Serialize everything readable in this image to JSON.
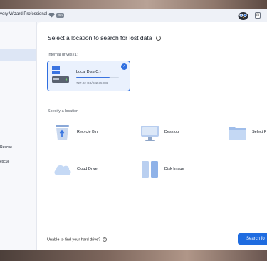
{
  "window": {
    "title": "very Wizard Professional",
    "badge": "Pro",
    "minimize": "⊡"
  },
  "sidebar": {
    "items": [
      {
        "label": ""
      },
      {
        "label": "Rescue"
      },
      {
        "label": "escue"
      }
    ]
  },
  "main": {
    "heading": "Select a location to search for lost data",
    "internal_label": "Internal drives (1)",
    "drive": {
      "name": "Local Disk(C:)",
      "size": "727.02 GB/932.35 GB",
      "used_fraction": 0.78
    },
    "specify_label": "Specify a location",
    "locations": [
      {
        "label": "Recycle Bin",
        "icon": "recycle-bin-icon"
      },
      {
        "label": "Desktop",
        "icon": "desktop-icon"
      },
      {
        "label": "Select F",
        "icon": "folder-icon"
      },
      {
        "label": "Cloud Drive",
        "icon": "cloud-icon"
      },
      {
        "label": "Disk Image",
        "icon": "disk-image-icon"
      }
    ]
  },
  "footer": {
    "help_text": "Unable to find your hard drive?",
    "search_button": "Search fo"
  },
  "colors": {
    "accent": "#1f6ce0",
    "selected_bg": "#eaf1fd",
    "sidebar_active": "#dde6f5"
  }
}
